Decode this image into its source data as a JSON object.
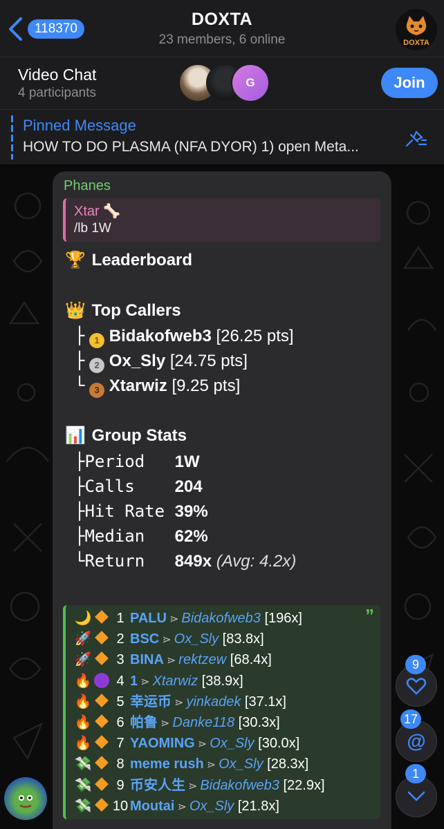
{
  "header": {
    "back_count": "118370",
    "title": "DOXTA",
    "subtitle": "23 members, 6 online",
    "avatar_text": "DOXTA"
  },
  "video_chat": {
    "title": "Video Chat",
    "subtitle": "4 participants",
    "avatar_initial": "G",
    "join_label": "Join"
  },
  "pinned": {
    "title": "Pinned Message",
    "text": "HOW TO DO PLASMA (NFA DYOR) 1) open Meta..."
  },
  "message": {
    "sender": "Phanes",
    "reply": {
      "name": "Xtar 🦴",
      "text": "/lb 1W"
    },
    "leaderboard_title": "Leaderboard",
    "top_callers_title": "Top Callers",
    "top_callers": [
      {
        "prefix": "├",
        "name": "Bidakofweb3",
        "pts": "[26.25 pts]",
        "medal": "1"
      },
      {
        "prefix": "├",
        "name": "Ox_Sly",
        "pts": "[24.75 pts]",
        "medal": "2"
      },
      {
        "prefix": "└",
        "name": "Xtarwiz",
        "pts": "[9.25 pts]",
        "medal": "3"
      }
    ],
    "group_stats_title": "Group Stats",
    "stats": [
      {
        "prefix": "├",
        "label": "Period",
        "value": "1W",
        "extra": ""
      },
      {
        "prefix": "├",
        "label": "Calls",
        "value": "204",
        "extra": ""
      },
      {
        "prefix": "├",
        "label": "Hit Rate",
        "value": "39%",
        "extra": ""
      },
      {
        "prefix": "├",
        "label": "Median",
        "value": "62%",
        "extra": ""
      },
      {
        "prefix": "└",
        "label": "Return",
        "value": "849x",
        "extra": "(Avg: 4.2x)"
      }
    ],
    "calls": [
      {
        "emoji": "🌙",
        "marker": "diamond",
        "rank": "1",
        "token": "PALU",
        "caller": "Bidakofweb3",
        "mult": "[196x]"
      },
      {
        "emoji": "🚀",
        "marker": "diamond",
        "rank": "2",
        "token": "BSC",
        "caller": "Ox_Sly",
        "mult": "[83.8x]"
      },
      {
        "emoji": "🚀",
        "marker": "diamond",
        "rank": "3",
        "token": "BINA",
        "caller": "rektzew",
        "mult": "[68.4x]"
      },
      {
        "emoji": "🔥",
        "marker": "purple",
        "rank": "4",
        "token": "1",
        "caller": "Xtarwiz",
        "mult": "[38.9x]"
      },
      {
        "emoji": "🔥",
        "marker": "diamond",
        "rank": "5",
        "token": "幸运币",
        "caller": "yinkadek",
        "mult": "[37.1x]"
      },
      {
        "emoji": "🔥",
        "marker": "diamond",
        "rank": "6",
        "token": "帕鲁",
        "caller": "Danke118",
        "mult": "[30.3x]"
      },
      {
        "emoji": "🔥",
        "marker": "diamond",
        "rank": "7",
        "token": "YAOMING",
        "caller": "Ox_Sly",
        "mult": "[30.0x]"
      },
      {
        "emoji": "💸",
        "marker": "diamond",
        "rank": "8",
        "token": "meme rush",
        "caller": "Ox_Sly",
        "mult": "[28.3x]"
      },
      {
        "emoji": "💸",
        "marker": "diamond",
        "rank": "9",
        "token": "币安人生",
        "caller": "Bidakofweb3",
        "mult": "[22.9x]"
      },
      {
        "emoji": "💸",
        "marker": "diamond",
        "rank": "10",
        "token": "Moutai",
        "caller": "Ox_Sly",
        "mult": "[21.8x]"
      }
    ]
  },
  "floating": {
    "reactions_count": "9",
    "mentions_count": "17",
    "unread_count": "1"
  },
  "colors": {
    "accent": "#3e88f7",
    "sender": "#6fcf6f",
    "link": "#5aa3f5",
    "reply_border": "#e06ca3",
    "quote_border": "#4fbf4f"
  }
}
